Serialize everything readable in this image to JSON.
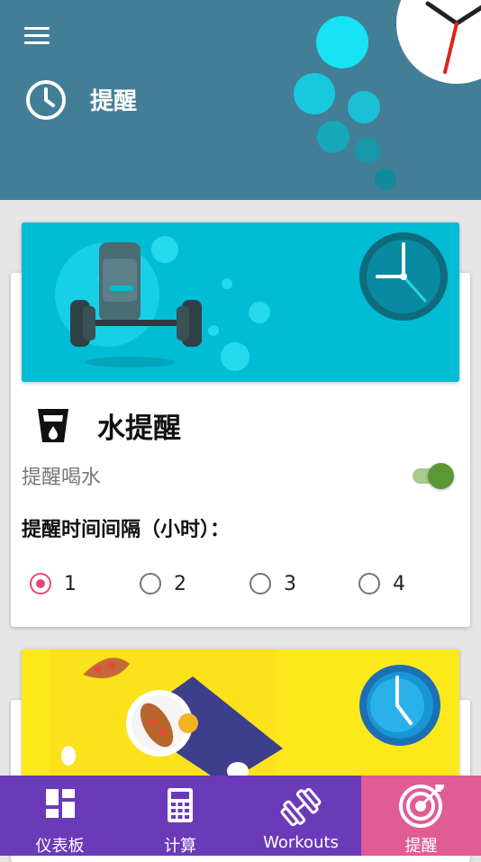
{
  "header": {
    "title": "提醒",
    "menu_icon": "hamburger-menu-icon",
    "title_icon": "clock-icon",
    "background_color": "#437e97"
  },
  "water_card": {
    "banner_color": "#00bcd4",
    "icon": "water-glass-icon",
    "title": "水提醒",
    "switch_label": "提醒喝水",
    "switch_on": true,
    "interval_label": "提醒时间间隔（小时）：",
    "options": [
      "1",
      "2",
      "3",
      "4"
    ],
    "selected_option": "1"
  },
  "meal_card": {
    "banner_color": "#fde81b"
  },
  "bottom_nav": {
    "background_color": "#6b3ab8",
    "active_color": "#e05c95",
    "items": [
      {
        "label": "仪表板",
        "icon": "dashboard-icon"
      },
      {
        "label": "计算",
        "icon": "calculator-icon"
      },
      {
        "label": "Workouts",
        "icon": "dumbbell-icon"
      },
      {
        "label": "提醒",
        "icon": "target-icon",
        "active": true
      }
    ]
  }
}
